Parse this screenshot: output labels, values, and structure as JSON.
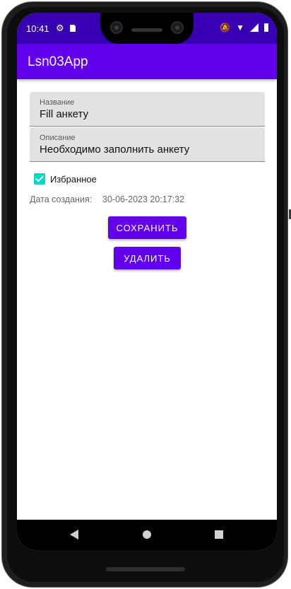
{
  "status_bar": {
    "time": "10:41",
    "icons": [
      "gear-icon",
      "sd-card-icon",
      "bell-off-icon",
      "wifi-icon",
      "signal-icon",
      "battery-icon"
    ]
  },
  "app_bar": {
    "title": "Lsn03App"
  },
  "form": {
    "name_field": {
      "label": "Название",
      "value": "Fill анкету"
    },
    "description_field": {
      "label": "Описание",
      "value": "Необходимо заполнить анкету"
    },
    "favorite": {
      "label": "Избранное",
      "checked": true
    },
    "created": {
      "label": "Дата создания:",
      "value": "30-06-2023 20:17:32"
    },
    "save_label": "СОХРАНИТЬ",
    "delete_label": "УДАЛИТЬ"
  },
  "nav_bar": {
    "icons": [
      "back-icon",
      "home-icon",
      "recents-icon"
    ]
  },
  "colors": {
    "status_bar": "#3700b3",
    "primary": "#6200ee",
    "accent": "#03dac5"
  }
}
